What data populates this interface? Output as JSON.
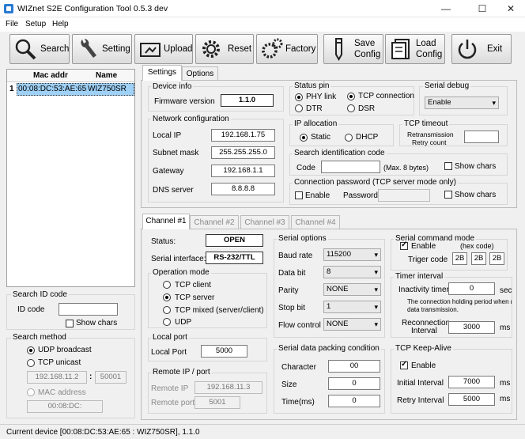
{
  "window": {
    "title": "WIZnet S2E Configuration Tool 0.5.3 dev",
    "min": "—",
    "max": "☐",
    "close": "✕"
  },
  "menu": [
    "File",
    "Setup",
    "Help"
  ],
  "toolbar": {
    "search": "Search",
    "setting": "Setting",
    "upload": "Upload",
    "reset": "Reset",
    "factory": "Factory",
    "save1": "Save",
    "save2": "Config",
    "load1": "Load",
    "load2": "Config",
    "exit": "Exit"
  },
  "device_list": {
    "col_mac": "Mac addr",
    "col_name": "Name",
    "rows": [
      {
        "idx": "1",
        "mac": "00:08:DC:53:AE:65",
        "name": "WIZ750SR"
      }
    ]
  },
  "search_id": {
    "title": "Search ID code",
    "label": "ID code",
    "value": "",
    "show": "Show chars"
  },
  "search_method": {
    "title": "Search method",
    "udp": "UDP broadcast",
    "tcp": "TCP unicast",
    "ip": "192.168.11.2",
    "sep": ":",
    "port": "50001",
    "mac_label": "MAC address",
    "mac": "00:08:DC:"
  },
  "tabs": {
    "settings": "Settings",
    "options": "Options"
  },
  "device_info": {
    "title": "Device info",
    "fw_label": "Firmware version",
    "fw": "1.1.0"
  },
  "netcfg": {
    "title": "Network configuration",
    "ip_l": "Local IP",
    "ip": "192.168.1.75",
    "mask_l": "Subnet mask",
    "mask": "255.255.255.0",
    "gw_l": "Gateway",
    "gw": "192.168.1.1",
    "dns_l": "DNS server",
    "dns": "8.8.8.8"
  },
  "status_pin": {
    "title": "Status pin",
    "phy": "PHY link",
    "dtr": "DTR",
    "tcp": "TCP connection",
    "dsr": "DSR"
  },
  "serial_debug": {
    "title": "Serial debug",
    "value": "Enable"
  },
  "ip_alloc": {
    "title": "IP allocation",
    "static": "Static",
    "dhcp": "DHCP"
  },
  "tcp_timeout": {
    "title": "TCP timeout",
    "l1": "Retransmission",
    "l2": "Retry count",
    "value": ""
  },
  "search_code": {
    "title": "Search identification code",
    "code_l": "Code",
    "hint": "(Max. 8 bytes)",
    "show": "Show chars"
  },
  "conn_pw": {
    "title": "Connection password (TCP server mode only)",
    "enable": "Enable",
    "pw_l": "Password",
    "show": "Show chars"
  },
  "channels": [
    "Channel #1",
    "Channel #2",
    "Channel #3",
    "Channel #4"
  ],
  "ch": {
    "status_l": "Status:",
    "status": "OPEN",
    "iface_l": "Serial interface:",
    "iface": "RS-232/TTL"
  },
  "opmode": {
    "title": "Operation mode",
    "client": "TCP client",
    "server": "TCP server",
    "mixed": "TCP mixed (server/client)",
    "udp": "UDP"
  },
  "localport": {
    "title": "Local port",
    "label": "Local Port",
    "value": "5000"
  },
  "remote": {
    "title": "Remote IP / port",
    "ip_l": "Remote IP",
    "ip": "192.168.11.3",
    "port_l": "Remote port",
    "port": "5001"
  },
  "serial_opt": {
    "title": "Serial options",
    "baud_l": "Baud rate",
    "baud": "115200",
    "data_l": "Data bit",
    "data": "8",
    "parity_l": "Parity",
    "parity": "NONE",
    "stop_l": "Stop bit",
    "stop": "1",
    "flow_l": "Flow control",
    "flow": "NONE"
  },
  "packing": {
    "title": "Serial data packing condition",
    "char_l": "Character",
    "char": "00",
    "size_l": "Size",
    "size": "0",
    "time_l": "Time(ms)",
    "time": "0"
  },
  "serial_cmd": {
    "title": "Serial command mode",
    "enable": "Enable",
    "hex": "(hex code)",
    "trig_l": "Triger code",
    "t1": "2B",
    "t2": "2B",
    "t3": "2B"
  },
  "timer": {
    "title": "Timer interval",
    "inact_l": "Inactivity timer",
    "inact": "0",
    "unit1": "sec",
    "note1": "The connection holding period when n",
    "note2": "data transmission.",
    "recon1": "Reconnection",
    "recon2": "Interval",
    "recon": "3000",
    "unit2": "ms"
  },
  "keepalive": {
    "title": "TCP Keep-Alive",
    "enable": "Enable",
    "init_l": "Initial Interval",
    "init": "7000",
    "unit1": "ms",
    "retry_l": "Retry Interval",
    "retry": "5000",
    "unit2": "ms"
  },
  "statusbar": "Current device [00:08:DC:53:AE:65 : WIZ750SR], 1.1.0"
}
